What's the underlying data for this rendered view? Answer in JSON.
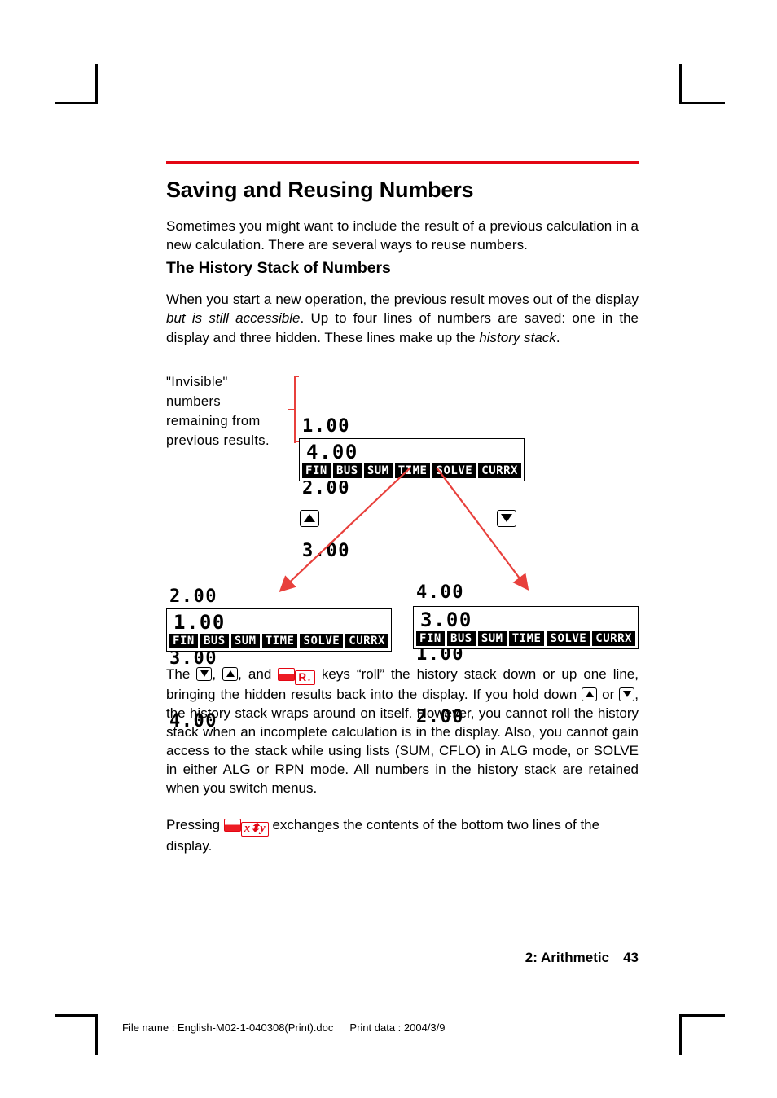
{
  "document": {
    "chapter_title": "Saving and Reusing Numbers",
    "rule_color": "#e30613",
    "intro_paragraph": "Sometimes you might want to include the result of a previous calculation in a new calculation. There are several ways to reuse numbers.",
    "section_title": "The History Stack of Numbers",
    "lead_paragraph_part1": "When you start a new operation, the previous result moves out of the display ",
    "lead_paragraph_italic1": "but is still accessible",
    "lead_paragraph_part2": ". Up to four lines of numbers are saved: one in the display and three hidden. These lines make up the ",
    "lead_paragraph_italic2": "history stack",
    "lead_paragraph_part3": "."
  },
  "diagram": {
    "callout_label": "\"Invisible\"\nnumbers\nremaining from\nprevious results.",
    "bracket_color": "#e8403c",
    "arrow_color": "#e8403c",
    "menu_labels": [
      "FIN",
      "BUS",
      "SUM",
      "TIME",
      "SOLVE",
      "CURRX"
    ],
    "top_display": {
      "hidden_lines": [
        "1.00",
        "2.00",
        "3.00"
      ],
      "display_value": "4.00"
    },
    "keys": {
      "left_key_icon": "up-arrow-key",
      "right_key_icon": "down-arrow-key"
    },
    "left_display": {
      "hidden_lines": [
        "2.00",
        "3.00",
        "4.00"
      ],
      "display_value": "1.00"
    },
    "right_display": {
      "hidden_lines": [
        "4.00",
        "1.00",
        "2.00"
      ],
      "display_value": "3.00"
    }
  },
  "body": {
    "para_roll": {
      "t1": "The ",
      "key_down_icon": "down-arrow-key",
      "t2": ", ",
      "key_up_icon": "up-arrow-key",
      "t3": ", and ",
      "shift_icon": "red-shift-key",
      "roll_key_label": "R↓",
      "t4": " keys “roll” the history stack down or up one line, bringing the hidden results back into the display. If you hold down ",
      "t5": " or ",
      "t6": ", the history stack wraps around on itself. However, you cannot roll the history stack when an incomplete calculation is in the display. Also, you cannot gain access to the stack while using lists (SUM, CFLO) in ALG mode, or SOLVE in either ALG or RPN mode. All numbers in the history stack are retained when you switch menus."
    },
    "para_swap": {
      "t1": "Pressing ",
      "shift_icon": "red-shift-key",
      "swap_key_label": "x⬍y",
      "t2": " exchanges the contents of the bottom two lines of the display."
    }
  },
  "footer": {
    "chapter_ref": "2: Arithmetic",
    "page_number": "43",
    "file_name_label": "File name : English-M02-1-040308(Print).doc",
    "print_date_label": "Print data : 2004/3/9"
  }
}
